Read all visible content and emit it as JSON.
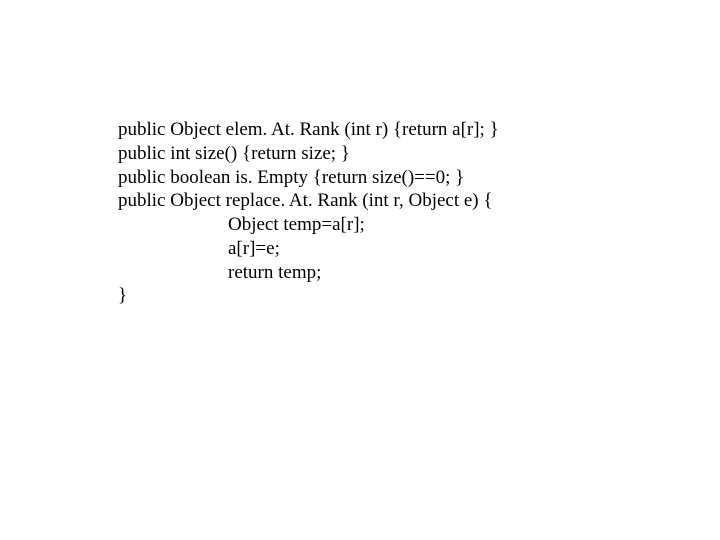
{
  "code": {
    "line1": "public Object elem. At. Rank (int r) {return a[r]; }",
    "line2": "public int size() {return size; }",
    "line3": "public boolean is. Empty {return size()==0; }",
    "line4": "public Object replace. At. Rank (int r, Object e) {",
    "line5": "Object temp=a[r];",
    "line6": "a[r]=e;",
    "line7": "return temp;",
    "line8": "}"
  }
}
